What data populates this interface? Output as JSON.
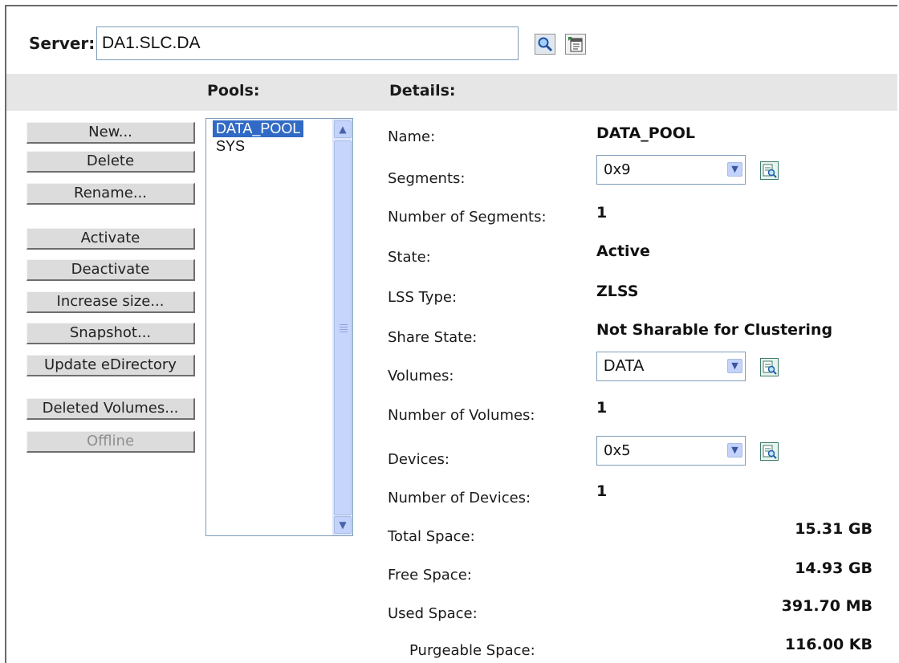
{
  "server": {
    "label": "Server:",
    "value": "DA1.SLC.DA"
  },
  "headers": {
    "pools": "Pools:",
    "details": "Details:"
  },
  "actions": [
    {
      "label": "New...",
      "enabled": true
    },
    {
      "label": "Delete",
      "enabled": true
    },
    {
      "label": "Rename...",
      "enabled": true
    },
    {
      "label": "Activate",
      "enabled": true
    },
    {
      "label": "Deactivate",
      "enabled": true
    },
    {
      "label": "Increase size...",
      "enabled": true
    },
    {
      "label": "Snapshot...",
      "enabled": true
    },
    {
      "label": "Update eDirectory",
      "enabled": true
    },
    {
      "label": "Deleted Volumes...",
      "enabled": true
    },
    {
      "label": "Offline",
      "enabled": false
    }
  ],
  "pools": [
    {
      "name": "DATA_POOL",
      "selected": true
    },
    {
      "name": "SYS",
      "selected": false
    }
  ],
  "details": {
    "name": {
      "label": "Name:",
      "value": "DATA_POOL"
    },
    "segments": {
      "label": "Segments:",
      "value": "0x9"
    },
    "num_segments": {
      "label": "Number of Segments:",
      "value": "1"
    },
    "state": {
      "label": "State:",
      "value": "Active"
    },
    "lss_type": {
      "label": "LSS Type:",
      "value": "ZLSS"
    },
    "share_state": {
      "label": "Share State:",
      "value": "Not Sharable for Clustering"
    },
    "volumes": {
      "label": "Volumes:",
      "value": "DATA"
    },
    "num_volumes": {
      "label": "Number of Volumes:",
      "value": "1"
    },
    "devices": {
      "label": "Devices:",
      "value": "0x5"
    },
    "num_devices": {
      "label": "Number of Devices:",
      "value": "1"
    },
    "total_space": {
      "label": "Total Space:",
      "value": "15.31 GB"
    },
    "free_space": {
      "label": "Free Space:",
      "value": "14.93 GB"
    },
    "used_space": {
      "label": "Used Space:",
      "value": "391.70 MB"
    },
    "purgeable_space": {
      "label": "Purgeable Space:",
      "value": "116.00 KB"
    }
  },
  "colors": {
    "selection": "#316ac5",
    "header_band": "#e6e6e6",
    "button_face": "#dcdcdc"
  }
}
